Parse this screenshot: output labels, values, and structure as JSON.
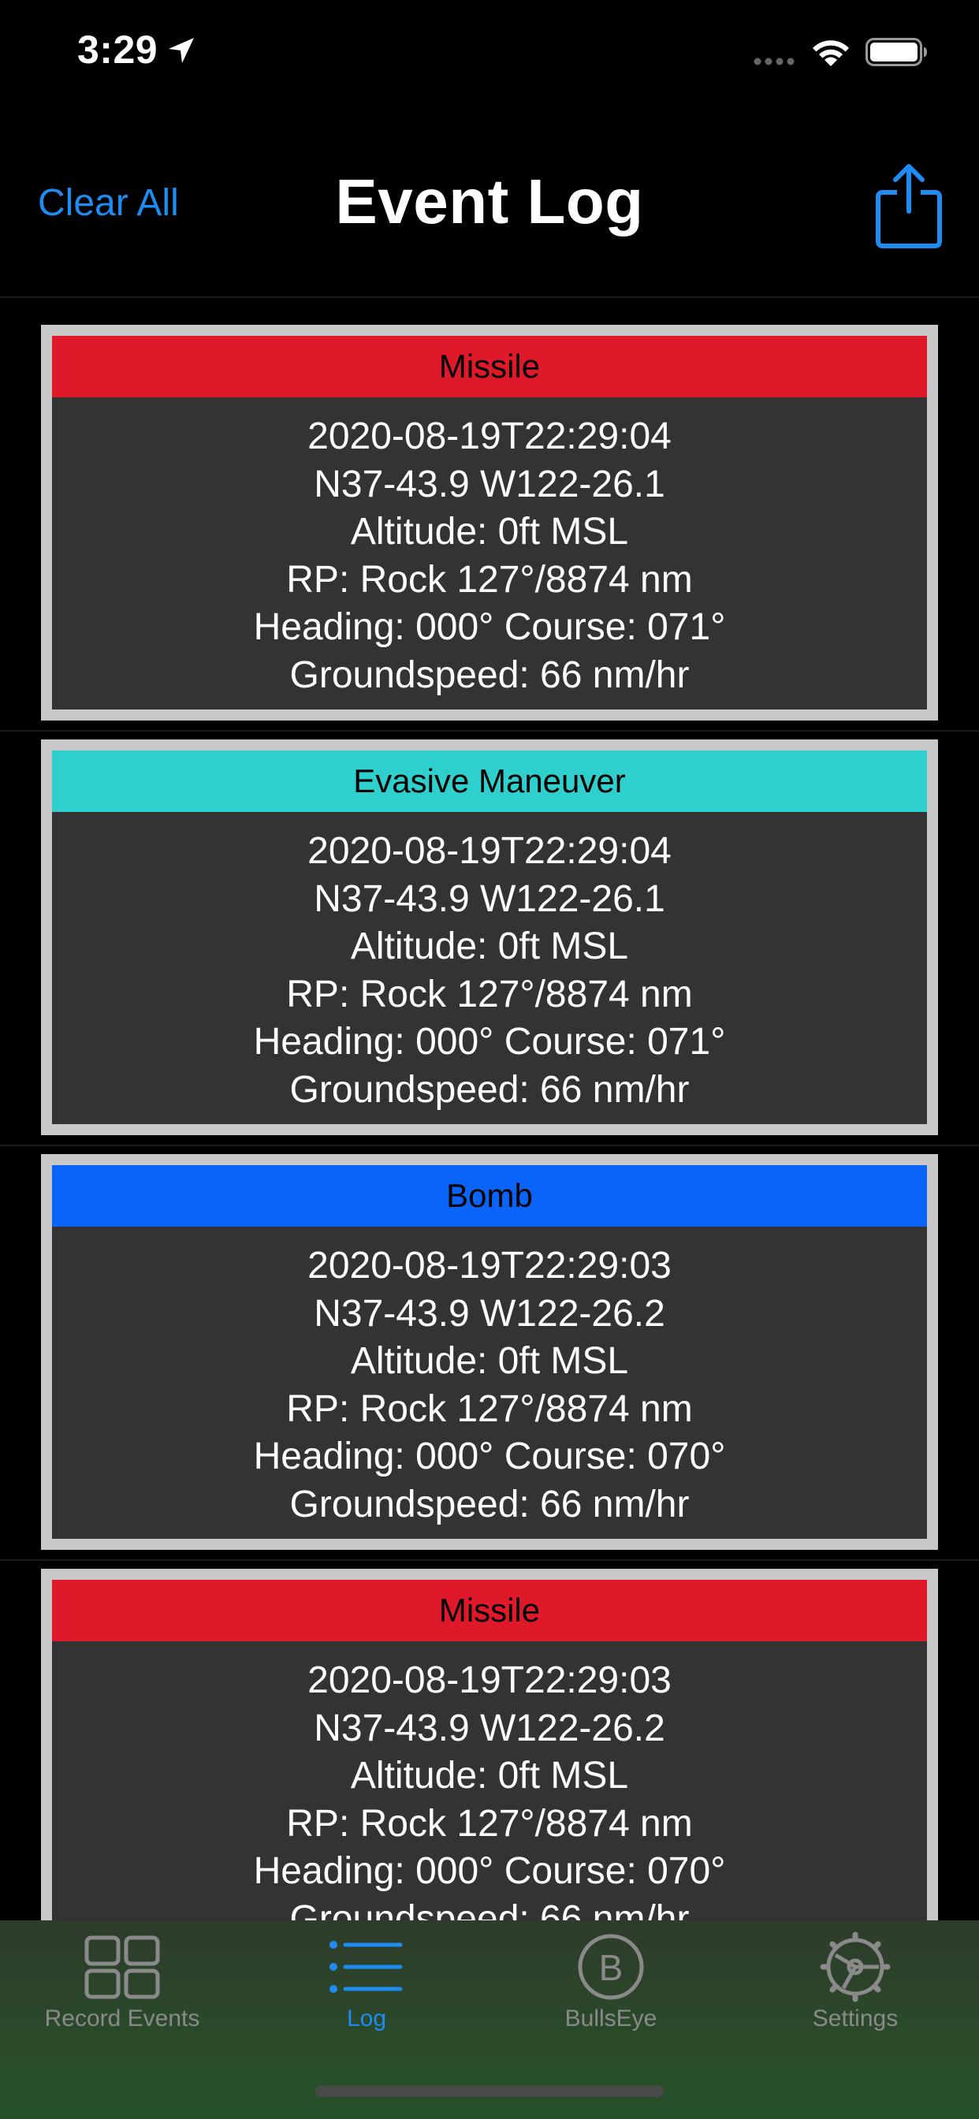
{
  "status_bar": {
    "time": "3:29"
  },
  "nav": {
    "left_button": "Clear All",
    "title": "Event Log"
  },
  "events": [
    {
      "type": "Missile",
      "color": "#e0192a",
      "lines": [
        "2020-08-19T22:29:04",
        "N37-43.9 W122-26.1",
        "Altitude: 0ft MSL",
        "RP: Rock 127°/8874 nm",
        "Heading: 000° Course: 071°",
        "Groundspeed: 66 nm/hr"
      ]
    },
    {
      "type": "Evasive Maneuver",
      "color": "#2ecfcc",
      "lines": [
        "2020-08-19T22:29:04",
        "N37-43.9 W122-26.1",
        "Altitude: 0ft MSL",
        "RP: Rock 127°/8874 nm",
        "Heading: 000° Course: 071°",
        "Groundspeed: 66 nm/hr"
      ]
    },
    {
      "type": "Bomb",
      "color": "#0a64fa",
      "lines": [
        "2020-08-19T22:29:03",
        "N37-43.9 W122-26.2",
        "Altitude: 0ft MSL",
        "RP: Rock 127°/8874 nm",
        "Heading: 000° Course: 070°",
        "Groundspeed: 66 nm/hr"
      ]
    },
    {
      "type": "Missile",
      "color": "#e0192a",
      "lines": [
        "2020-08-19T22:29:03",
        "N37-43.9 W122-26.2",
        "Altitude: 0ft MSL",
        "RP: Rock 127°/8874 nm",
        "Heading: 000° Course: 070°",
        "Groundspeed: 66 nm/hr"
      ]
    }
  ],
  "tabs": [
    {
      "label": "Record Events",
      "icon": "grid-icon",
      "active": false
    },
    {
      "label": "Log",
      "icon": "list-icon",
      "active": true
    },
    {
      "label": "BullsEye",
      "icon": "bullseye-b-icon",
      "active": false
    },
    {
      "label": "Settings",
      "icon": "gear-icon",
      "active": false
    }
  ],
  "colors": {
    "accent": "#1e8cf0",
    "card_border": "#c8c8c8",
    "card_body": "#333333",
    "tab_inactive": "#8a8a8a"
  }
}
